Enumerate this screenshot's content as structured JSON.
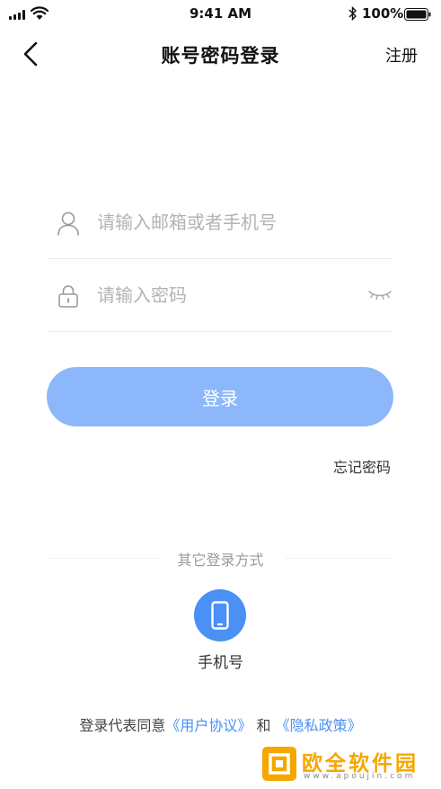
{
  "status_bar": {
    "time": "9:41 AM",
    "battery_percent": "100%"
  },
  "nav": {
    "title": "账号密码登录",
    "register_label": "注册"
  },
  "form": {
    "account_placeholder": "请输入邮箱或者手机号",
    "password_placeholder": "请输入密码",
    "login_label": "登录",
    "forgot_label": "忘记密码"
  },
  "other_login": {
    "title": "其它登录方式",
    "phone_label": "手机号"
  },
  "agreement": {
    "prefix": "登录代表同意",
    "user_agreement": "《用户协议》",
    "and": " 和 ",
    "privacy_policy": "《隐私政策》"
  },
  "watermark": {
    "brand": "欧全软件园",
    "url": "www.apoujin.com"
  },
  "colors": {
    "button": "#8db7fb",
    "accent": "#4a90f5",
    "watermark": "#f5a700"
  }
}
